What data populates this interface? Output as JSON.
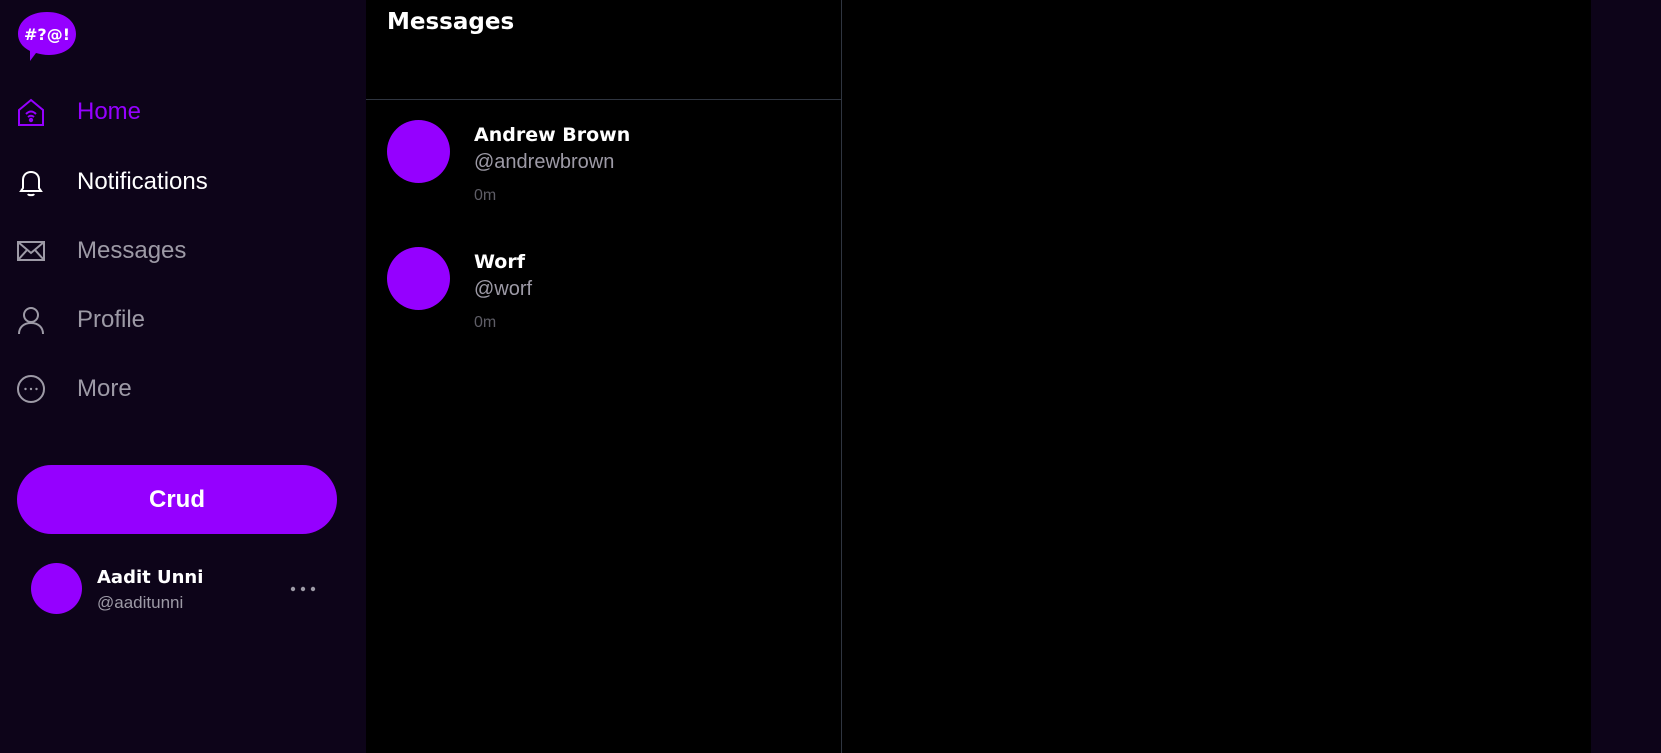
{
  "brand": {
    "logo_text": "#?@!",
    "accent": "#9500ff"
  },
  "sidebar": {
    "items": [
      {
        "label": "Home",
        "icon": "home-icon",
        "active": true
      },
      {
        "label": "Notifications",
        "icon": "bell-icon"
      },
      {
        "label": "Messages",
        "icon": "envelope-icon"
      },
      {
        "label": "Profile",
        "icon": "user-icon"
      },
      {
        "label": "More",
        "icon": "more-circle-icon"
      }
    ],
    "crud_label": "Crud",
    "profile": {
      "name": "Aadit Unni",
      "handle": "@aaditunni"
    }
  },
  "messages": {
    "title": "Messages",
    "conversations": [
      {
        "name": "Andrew Brown",
        "handle": "@andrewbrown",
        "time": "0m"
      },
      {
        "name": "Worf",
        "handle": "@worf",
        "time": "0m"
      }
    ]
  }
}
